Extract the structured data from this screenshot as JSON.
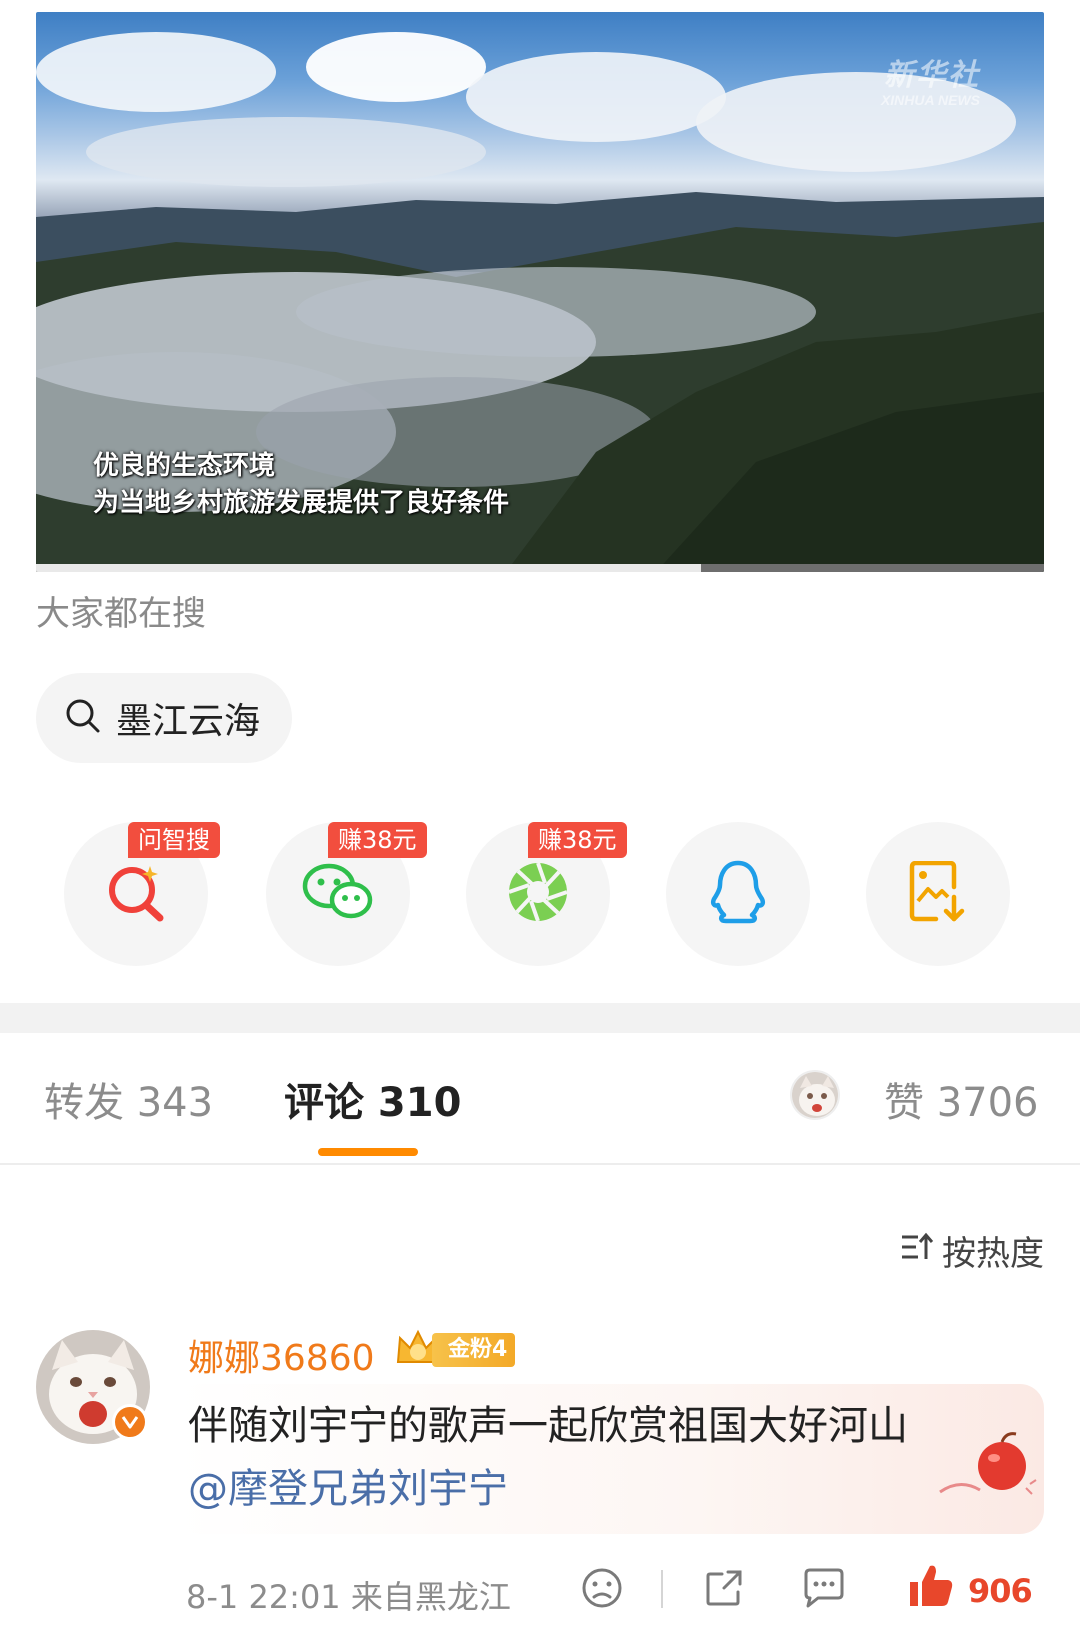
{
  "video": {
    "watermark_cn": "新华社",
    "watermark_en": "XINHUA NEWS",
    "subtitle_line1": "优良的生态环境",
    "subtitle_line2": "为当地乡村旅游发展提供了良好条件",
    "progress": 0.66
  },
  "search_section": {
    "title": "大家都在搜",
    "query": "墨江云海"
  },
  "share": {
    "items": [
      {
        "name": "ask-search",
        "icon": "ai-search-icon",
        "badge": "问智搜"
      },
      {
        "name": "wechat",
        "icon": "wechat-icon",
        "badge": "赚38元"
      },
      {
        "name": "moments",
        "icon": "wechat-moments-icon",
        "badge": "赚38元"
      },
      {
        "name": "qq",
        "icon": "qq-icon",
        "badge": ""
      },
      {
        "name": "save-image",
        "icon": "save-image-icon",
        "badge": ""
      }
    ]
  },
  "tabs": {
    "repost": "转发 343",
    "comment": "评论 310",
    "like": "赞 3706"
  },
  "sort": {
    "label": "按热度",
    "icon": "sort-icon"
  },
  "comment": {
    "username": "娜娜36860",
    "fan_badge": "金粉4",
    "text": "伴随刘宇宁的歌声一起欣赏祖国大好河山",
    "mention": "@摩登兄弟刘宇宁",
    "time": "8-1 22:01 来自黑龙江",
    "likes": "906"
  },
  "colors": {
    "accent": "#ff8a00",
    "name": "#f07a1a",
    "badge_red": "#f24e3e",
    "mention": "#4a6ea8",
    "wechat": "#2fbf4b",
    "qq": "#1e9ee8",
    "save": "#f2a400"
  }
}
